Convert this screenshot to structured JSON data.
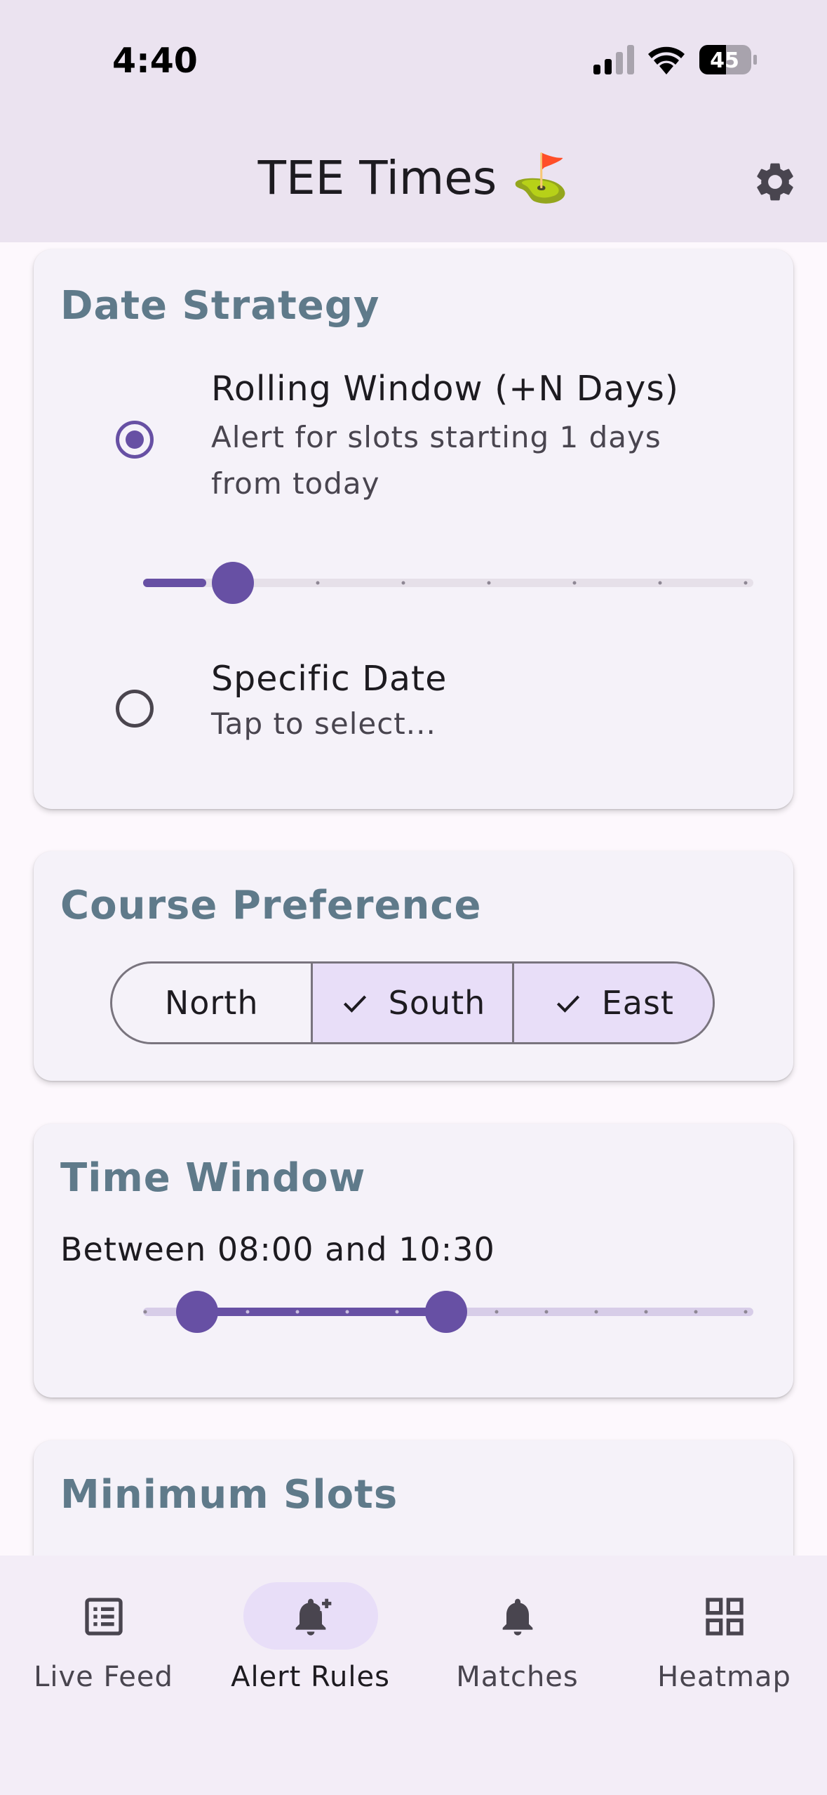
{
  "status_bar": {
    "time": "4:40",
    "battery": "45"
  },
  "app_bar": {
    "title": "TEE Times ⛳"
  },
  "date_strategy": {
    "title": "Date Strategy",
    "options": [
      {
        "title": "Rolling Window (+N Days)",
        "subtitle_line1": "Alert for slots starting 1 days",
        "subtitle_line2": "from today",
        "selected": true
      },
      {
        "title": "Specific Date",
        "subtitle_line1": "Tap to select...",
        "selected": false
      }
    ],
    "rolling_days_slider": {
      "min": 0,
      "max": 7,
      "value": 1
    }
  },
  "course_preference": {
    "title": "Course Preference",
    "options": [
      {
        "label": "North",
        "selected": false
      },
      {
        "label": "South",
        "selected": true
      },
      {
        "label": "East",
        "selected": true
      }
    ]
  },
  "time_window": {
    "title": "Time Window",
    "label": "Between 08:00 and 10:30",
    "slider": {
      "start": "08:00",
      "end": "10:30"
    }
  },
  "minimum_slots": {
    "title": "Minimum Slots"
  },
  "bottom_nav": {
    "items": [
      {
        "label": "Live Feed",
        "icon": "list-icon",
        "active": false
      },
      {
        "label": "Alert Rules",
        "icon": "bell-plus-icon",
        "active": true
      },
      {
        "label": "Matches",
        "icon": "bell-icon",
        "active": false
      },
      {
        "label": "Heatmap",
        "icon": "grid-icon",
        "active": false
      }
    ]
  },
  "colors": {
    "primary": "#6750a4",
    "title_blue_grey": "#5f7a8a",
    "secondary_container": "#e8def8",
    "app_bar": "#ebe3f0"
  }
}
